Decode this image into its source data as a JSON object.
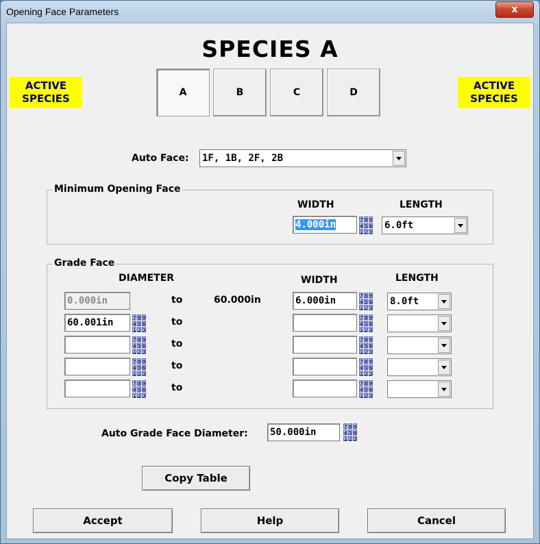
{
  "window": {
    "title": "Opening Face Parameters",
    "close_glyph": "x"
  },
  "species_title": "SPECIES A",
  "active_species_left": [
    "ACTIVE",
    "SPECIES"
  ],
  "active_species_right": [
    "ACTIVE",
    "SPECIES"
  ],
  "tabs": [
    {
      "label": "A",
      "selected": true
    },
    {
      "label": "B"
    },
    {
      "label": "C"
    },
    {
      "label": "D"
    }
  ],
  "auto_face": {
    "label": "Auto Face:",
    "value": "1F, 1B, 2F, 2B"
  },
  "min_opening_face": {
    "title": "Minimum Opening Face",
    "width_header": "WIDTH",
    "length_header": "LENGTH",
    "width_value": "4.000in",
    "length_value": "6.0ft"
  },
  "grade_face": {
    "title": "Grade Face",
    "diameter_header": "DIAMETER",
    "width_header": "WIDTH",
    "length_header": "LENGTH",
    "to_label": "to",
    "rows": [
      {
        "from": "0.000in",
        "to_value": "60.000in",
        "width": "6.000in",
        "length": "8.0ft"
      },
      {
        "from": "60.001in",
        "to_value": "",
        "width": "",
        "length": ""
      },
      {
        "from": "",
        "to_value": "",
        "width": "",
        "length": ""
      },
      {
        "from": "",
        "to_value": "",
        "width": "",
        "length": ""
      },
      {
        "from": "",
        "to_value": "",
        "width": "",
        "length": ""
      }
    ]
  },
  "auto_grade_face_diameter": {
    "label": "Auto Grade Face Diameter:",
    "value": "50.000in"
  },
  "keypad_digits": [
    "7",
    "8",
    "9",
    "4",
    "5",
    "6",
    "1",
    "2",
    "3"
  ],
  "buttons": {
    "copy_table": "Copy Table",
    "accept": "Accept",
    "help": "Help",
    "cancel": "Cancel"
  }
}
